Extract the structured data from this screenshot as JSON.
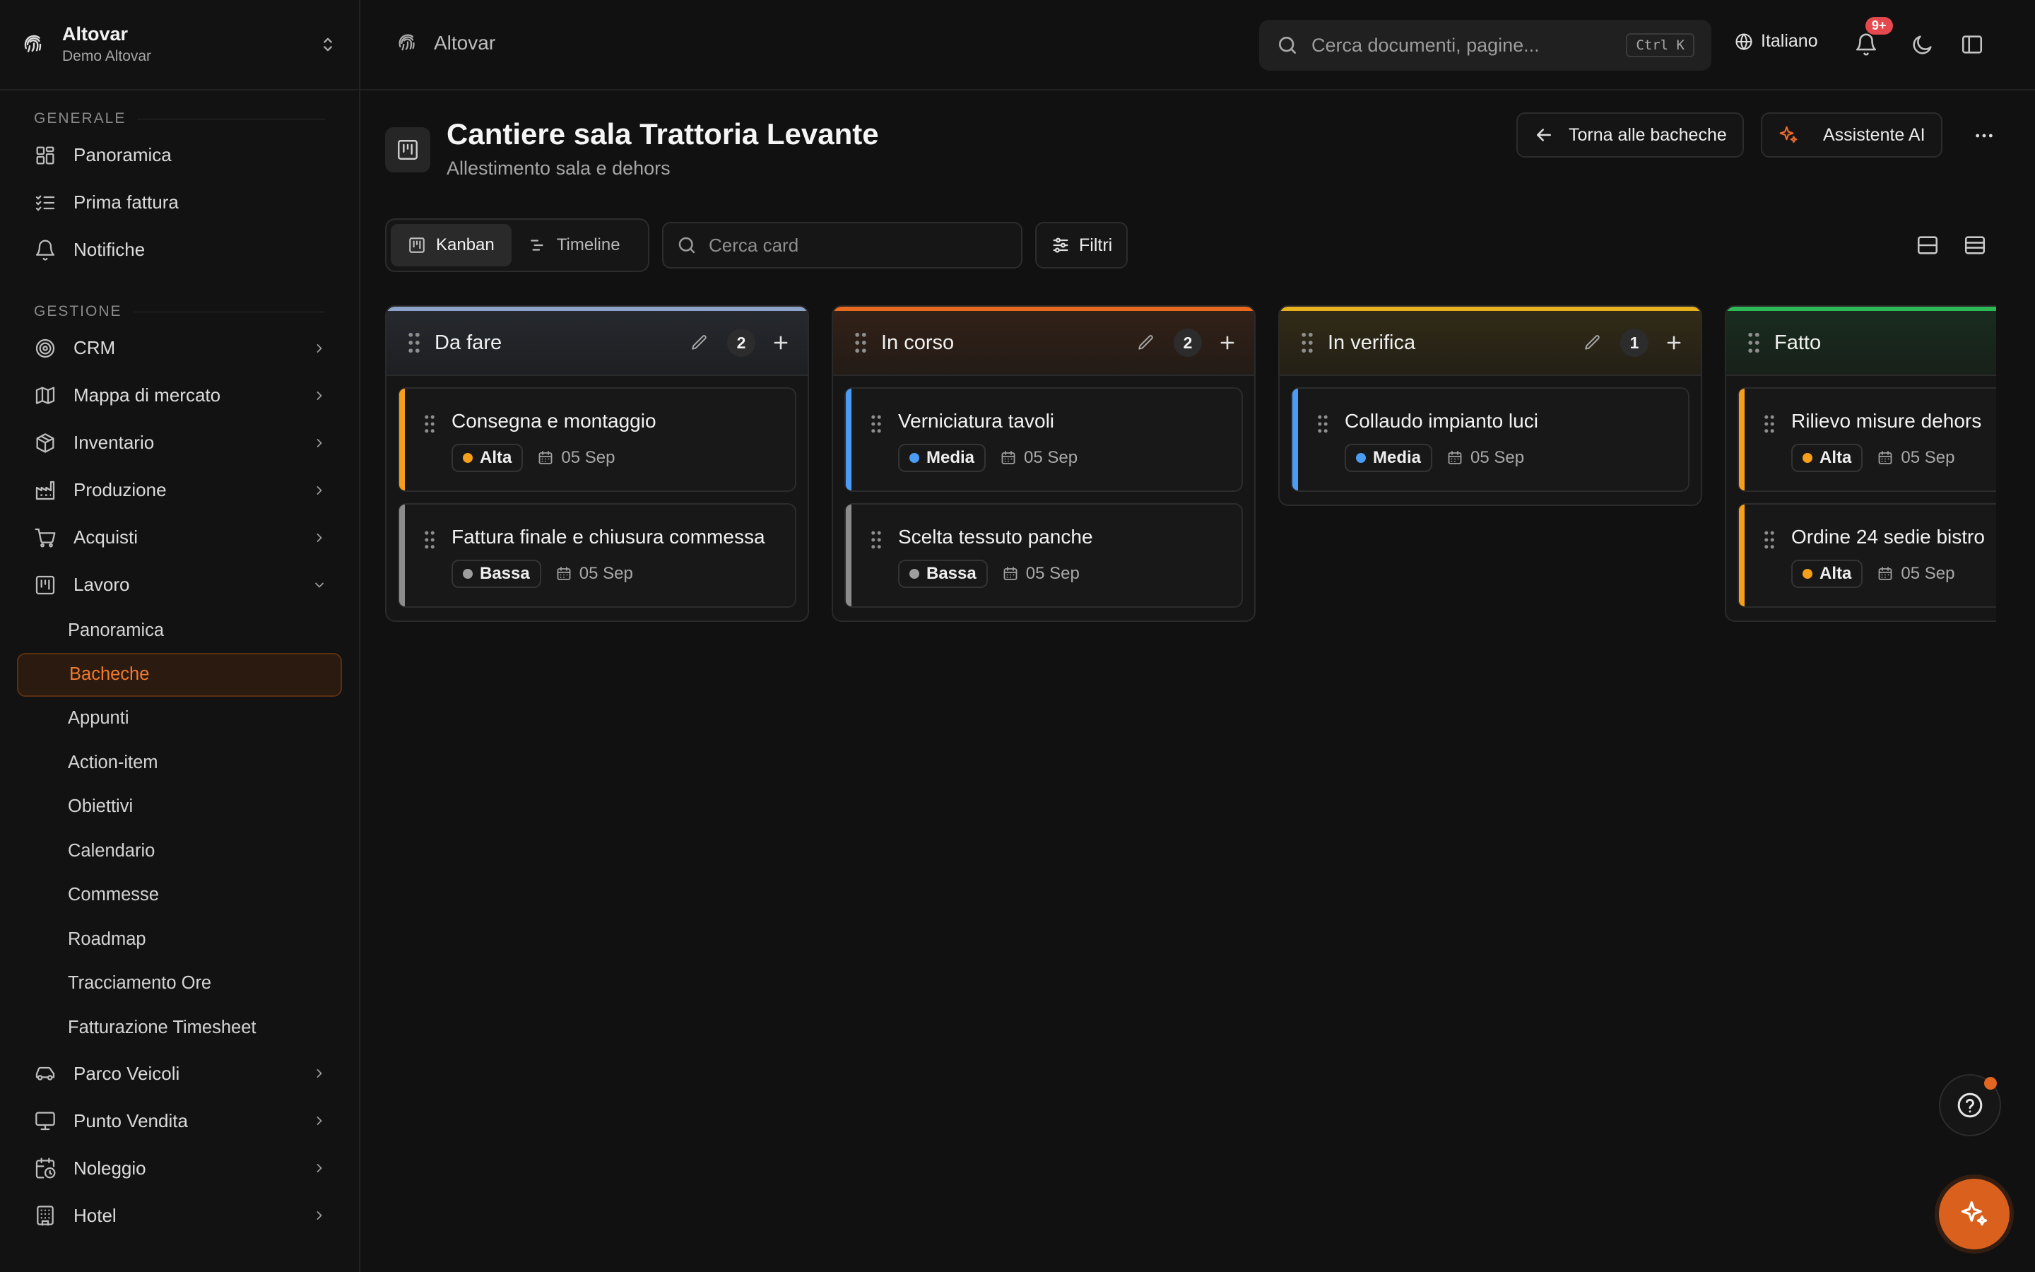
{
  "org": {
    "name": "Altovar",
    "subtitle": "Demo Altovar"
  },
  "sidebar": {
    "sections": [
      {
        "label": "GENERALE",
        "items": [
          "Panoramica",
          "Prima fattura",
          "Notifiche"
        ]
      },
      {
        "label": "GESTIONE",
        "items": [
          "CRM",
          "Mappa di mercato",
          "Inventario",
          "Produzione",
          "Acquisti",
          "Lavoro",
          "Parco Veicoli",
          "Punto Vendita",
          "Noleggio",
          "Hotel"
        ]
      }
    ],
    "lavoro_sub": [
      "Panoramica",
      "Bacheche",
      "Appunti",
      "Action-item",
      "Obiettivi",
      "Calendario",
      "Commesse",
      "Roadmap",
      "Tracciamento Ore",
      "Fatturazione Timesheet"
    ],
    "active_sub": "Bacheche"
  },
  "topbar": {
    "breadcrumb": "Altovar",
    "search_placeholder": "Cerca documenti, pagine...",
    "shortcut": "Ctrl K",
    "language": "Italiano",
    "notifications_badge": "9+"
  },
  "board": {
    "title": "Cantiere sala Trattoria Levante",
    "subtitle": "Allestimento sala e dehors",
    "back_label": "Torna alle bacheche",
    "ai_label": "Assistente AI",
    "views": [
      "Kanban",
      "Timeline"
    ],
    "active_view": "Kanban",
    "card_search_placeholder": "Cerca card",
    "filters_label": "Filtri"
  },
  "columns": [
    {
      "title": "Da fare",
      "count": "2",
      "color": "#8ea3c9",
      "cards": [
        {
          "title": "Consegna e montaggio",
          "priority": "Alta",
          "priority_color": "#f59f1a",
          "accent": "#f59f1a",
          "date": "05 Sep"
        },
        {
          "title": "Fattura finale e chiusura commessa",
          "priority": "Bassa",
          "priority_color": "#9e9e9e",
          "accent": "#8c8c8c",
          "date": "05 Sep"
        }
      ]
    },
    {
      "title": "In corso",
      "count": "2",
      "color": "#e8691f",
      "cards": [
        {
          "title": "Verniciatura tavoli",
          "priority": "Media",
          "priority_color": "#4a9cf5",
          "accent": "#4a9cf5",
          "date": "05 Sep"
        },
        {
          "title": "Scelta tessuto panche",
          "priority": "Bassa",
          "priority_color": "#9e9e9e",
          "accent": "#8c8c8c",
          "date": "05 Sep"
        }
      ]
    },
    {
      "title": "In verifica",
      "count": "1",
      "color": "#e6b11c",
      "cards": [
        {
          "title": "Collaudo impianto luci",
          "priority": "Media",
          "priority_color": "#4a9cf5",
          "accent": "#4a9cf5",
          "date": "05 Sep"
        }
      ]
    },
    {
      "title": "Fatto",
      "count": "",
      "color": "#2db955",
      "cards": [
        {
          "title": "Rilievo misure dehors",
          "priority": "Alta",
          "priority_color": "#f59f1a",
          "accent": "#f59f1a",
          "date": "05 Sep"
        },
        {
          "title": "Ordine 24 sedie bistro",
          "priority": "Alta",
          "priority_color": "#f59f1a",
          "accent": "#f59f1a",
          "date": "05 Sep"
        }
      ]
    }
  ],
  "colors": {
    "accent": "#d9601d",
    "background": "#111111"
  },
  "icons": [
    "fingerprint-icon",
    "chevrons-updown-icon",
    "search-icon",
    "globe-icon",
    "bell-icon",
    "moon-icon",
    "sidebar-toggle-icon",
    "board-icon",
    "arrow-left-icon",
    "sparkles-icon",
    "more-icon",
    "kanban-icon",
    "timeline-icon",
    "sliders-icon",
    "layout-rows-icon",
    "layout-list-icon",
    "grip-icon",
    "pencil-icon",
    "plus-icon",
    "calendar-icon",
    "help-icon"
  ]
}
